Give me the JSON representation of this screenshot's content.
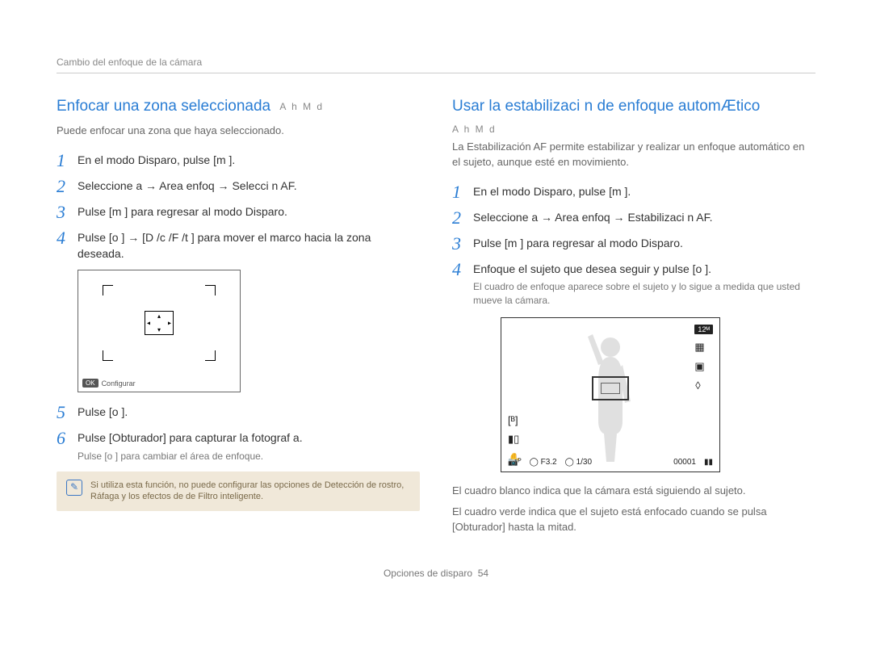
{
  "header": {
    "breadcrumb": "Cambio del enfoque de la cámara"
  },
  "left": {
    "title": "Enfocar una zona seleccionada",
    "modes": "A h M d",
    "intro": "Puede enfocar una zona que haya seleccionado.",
    "steps": [
      {
        "n": "1",
        "body": "En el modo Disparo, pulse [m     ]."
      },
      {
        "n": "2",
        "body": "Seleccione a     → Area enfoq → Selecci n AF."
      },
      {
        "n": "3",
        "body": "Pulse [m     ] para regresar al modo Disparo."
      },
      {
        "n": "4",
        "body": "Pulse [o   ] → [D    /c  /F /t    ] para mover el marco hacia la zona deseada."
      }
    ],
    "diagram": {
      "ok": "OK",
      "configure": "Conﬁgurar"
    },
    "steps2": [
      {
        "n": "5",
        "body": "Pulse [o   ]."
      },
      {
        "n": "6",
        "body": "Pulse [Obturador] para capturar la fotograf a.",
        "sub": "Pulse [o   ] para cambiar el área de enfoque."
      }
    ],
    "note": "Si utiliza esta función, no puede configurar las opciones de Detección de rostro, Ráfaga y los efectos de de Filtro inteligente."
  },
  "right": {
    "title": "Usar la estabilizaci n de enfoque automÆtico",
    "modes": "A h M d",
    "intro": "La Estabilización AF permite estabilizar y realizar un enfoque automático en el sujeto, aunque esté en movimiento.",
    "steps": [
      {
        "n": "1",
        "body": "En el modo Disparo, pulse [m     ]."
      },
      {
        "n": "2",
        "body": "Seleccione a     → Area enfoq → Estabilizaci n AF."
      },
      {
        "n": "3",
        "body": "Pulse [m     ] para regresar al modo Disparo."
      },
      {
        "n": "4",
        "body": "Enfoque el sujeto que desea seguir y pulse [o   ].",
        "sub": "El cuadro de enfoque aparece sobre el sujeto y lo sigue a medida que usted mueve la cámara."
      }
    ],
    "diagram": {
      "right_icons": [
        "12ᴹ",
        "▦",
        "▣",
        "ꕺ"
      ],
      "left_icons": [
        "[ᴮ]",
        "▮▯",
        "✋"
      ],
      "bottom": {
        "mode": "📷ᴾ",
        "fstop": "◯ F3.2",
        "shutter": "◯ 1/30",
        "counter": "00001",
        "battery": "▮▮"
      }
    },
    "after": [
      "El cuadro blanco indica que la cámara está siguiendo al sujeto.",
      "El cuadro verde indica que el sujeto está enfocado cuando se pulsa [Obturador] hasta la mitad."
    ]
  },
  "footer": {
    "section": "Opciones de disparo",
    "page": "54"
  }
}
